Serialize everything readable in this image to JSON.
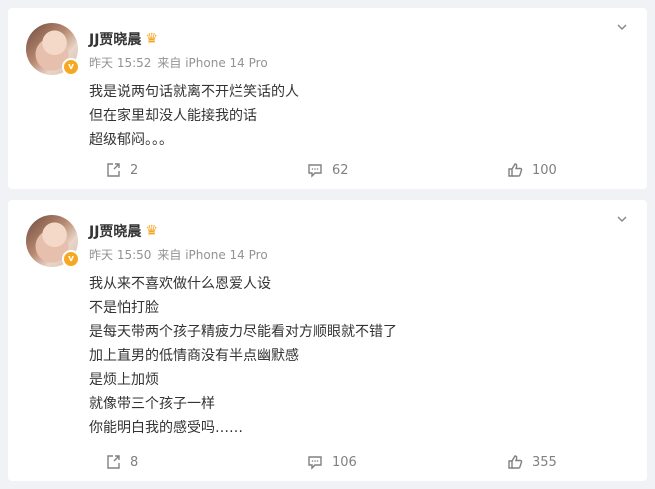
{
  "posts": [
    {
      "author": "JJ贾晓晨",
      "crown_icon": "crown-icon",
      "verified_icon": "verified-v-icon",
      "time": "昨天 15:52",
      "source": "来自 iPhone 14 Pro",
      "lines": [
        "我是说两句话就离不开烂笑话的人",
        "但在家里却没人能接我的话",
        "超级郁闷。。。"
      ],
      "shares": "2",
      "comments": "62",
      "likes": "100"
    },
    {
      "author": "JJ贾晓晨",
      "crown_icon": "crown-icon",
      "verified_icon": "verified-v-icon",
      "time": "昨天 15:50",
      "source": "来自 iPhone 14 Pro",
      "lines": [
        "我从来不喜欢做什么恩爱人设",
        "不是怕打脸",
        "是每天带两个孩子精疲力尽能看对方顺眼就不错了",
        "加上直男的低情商没有半点幽默感",
        "是烦上加烦",
        "就像带三个孩子一样",
        "你能明白我的感受吗……"
      ],
      "shares": "8",
      "comments": "106",
      "likes": "355"
    }
  ],
  "colors": {
    "background": "#f1f2f5",
    "card": "#ffffff",
    "verified": "#f7a823",
    "crown": "#f6a31a",
    "meta_text": "#939393"
  }
}
